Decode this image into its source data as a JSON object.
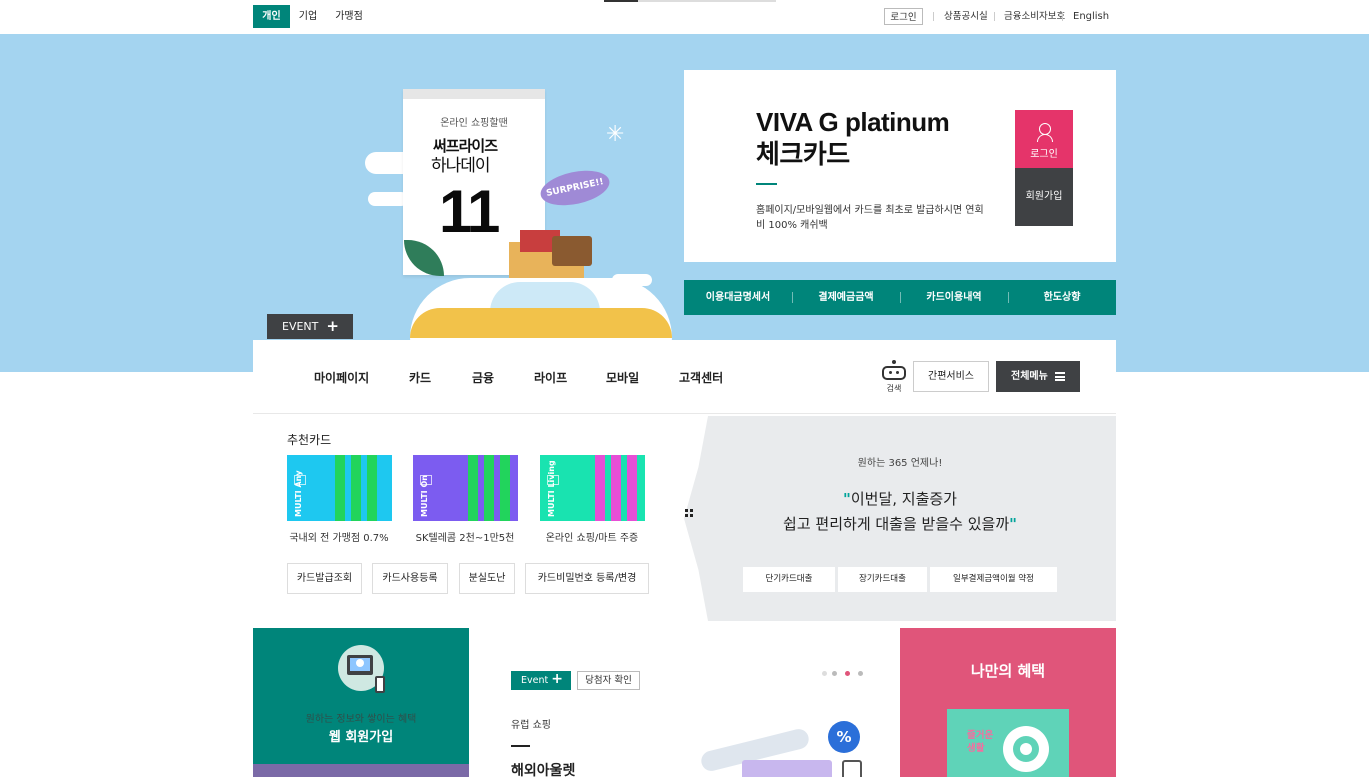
{
  "topbar": {
    "segments": [
      "개인",
      "기업",
      "가맹점"
    ],
    "utilities": [
      "로그인",
      "상품공시실",
      "금융소비자보호",
      "English"
    ]
  },
  "hero": {
    "calendar_subtitle": "온라인 쇼핑할땐",
    "calendar_title": "써프라이즈",
    "calendar_title2": "하나데이",
    "calendar_number": "11",
    "bubble_text": "SURPRISE!!",
    "event_button": "EVENT",
    "promo": {
      "title_line1": "VIVA G platinum",
      "title_line2": "체크카드",
      "description": "홈페이지/모바일웹에서 카드를 최초로 발급하시면 연회비 100% 캐쉬백",
      "login_label": "로그인",
      "join_label": "회원가입"
    },
    "quick_links": [
      "이용대금명세서",
      "결제예금금액",
      "카드이용내역",
      "한도상향"
    ]
  },
  "gnb": {
    "items": [
      "마이페이지",
      "카드",
      "금융",
      "라이프",
      "모바일",
      "고객센터"
    ],
    "search_label": "검색",
    "simple_service": "간편서비스",
    "all_menu": "전체메뉴"
  },
  "recommend": {
    "title": "추천카드",
    "cards": [
      {
        "label": "국내외 전 가맹점 0.7%",
        "brand": "MULTI Any",
        "colors": [
          "#1ec8f0",
          "#22d45c"
        ]
      },
      {
        "label": "SK텔레콤 2천~1만5천",
        "brand": "MULTI On",
        "colors": [
          "#7c5cf0",
          "#22d45c"
        ]
      },
      {
        "label": "온라인 쇼핑/마트 주증",
        "brand": "MULTI Living",
        "colors": [
          "#19e3b0",
          "#e64fd6"
        ]
      }
    ],
    "services": [
      "카드발급조회",
      "카드사용등록",
      "분실도난",
      "카드비밀번호 등록/변경"
    ]
  },
  "loan": {
    "subtitle": "원하는 365 언제나!",
    "title_line1": "이번달, 지출증가",
    "title_line2": "쉽고 편리하게 대출을 받을수 있을까",
    "open_quote": "\"",
    "close_quote": "\"",
    "buttons": [
      "단기카드대출",
      "장기카드대출",
      "일부결제금액이월 약정"
    ]
  },
  "join_panel": {
    "subtitle": "원하는 정보와 쌓이는 혜택",
    "title": "웹 회원가입"
  },
  "event": {
    "button": "Event",
    "winner_button": "당첨자 확인",
    "category": "유럽 쇼핑",
    "title": "해외아울렛",
    "badge": "%"
  },
  "benefit": {
    "title": "나만의 혜택",
    "card_text_line1": "즐거운",
    "card_text_line2": "생활"
  },
  "colors": {
    "brand": "#00857a",
    "hero_bg": "#a4d4f0",
    "accent_pink": "#e5346a",
    "dark": "#3f4144"
  }
}
